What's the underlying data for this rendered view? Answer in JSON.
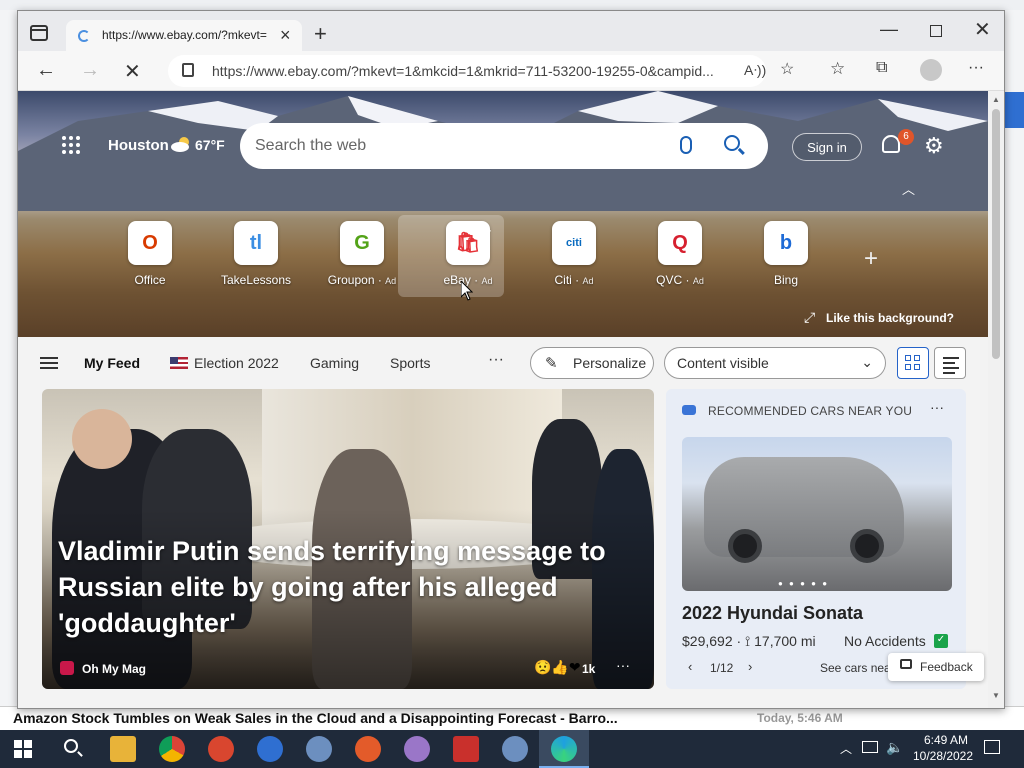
{
  "browser": {
    "tab_title": "https://www.ebay.com/?mkevt=",
    "address": "https://www.ebay.com/?mkevt=1&mkcid=1&mkrid=711-53200-19255-0&campid..."
  },
  "newtab": {
    "weather": {
      "city": "Houston",
      "temp": "67°F"
    },
    "search_placeholder": "Search the web",
    "signin": "Sign in",
    "notifications": "6",
    "quick_links": [
      {
        "label": "Office",
        "ad": "",
        "color": "#d83b01",
        "glyph": "O"
      },
      {
        "label": "TakeLessons",
        "ad": "",
        "color": "#3b8ee3",
        "glyph": "tl"
      },
      {
        "label": "Groupon",
        "ad": "Ad",
        "color": "#53a318",
        "glyph": "G"
      },
      {
        "label": "eBay",
        "ad": "Ad",
        "color": "#e53238",
        "glyph": "🛍"
      },
      {
        "label": "Citi",
        "ad": "Ad",
        "color": "#0a6bbf",
        "glyph": "citi"
      },
      {
        "label": "QVC",
        "ad": "Ad",
        "color": "#d6202f",
        "glyph": "Q"
      },
      {
        "label": "Bing",
        "ad": "",
        "color": "#1e6bd6",
        "glyph": "b"
      }
    ],
    "background_link": "Like this background?"
  },
  "feed_nav": {
    "my_feed": "My Feed",
    "items": [
      "Election 2022",
      "Gaming",
      "Sports"
    ],
    "personalize": "Personalize",
    "content_visible": "Content visible"
  },
  "story": {
    "title": "Vladimir Putin sends terrifying message to Russian elite by going after his alleged 'goddaughter'",
    "source": "Oh My Mag",
    "reactions": "1k"
  },
  "cars": {
    "header": "RECOMMENDED CARS NEAR YOU",
    "title": "2022 Hyundai Sonata",
    "price": "$29,692 · ⟟ 17,700 mi",
    "accidents": "No Accidents",
    "page": "1/12",
    "see_more": "See cars nea"
  },
  "feedback": "Feedback",
  "background_window": {
    "ticker": "Amazon Stock Tumbles on Weak Sales in the Cloud and a Disappointing Forecast - Barro...",
    "ticker_time": "Today, 5:46 AM"
  },
  "taskbar": {
    "time": "6:49 AM",
    "date": "10/28/2022"
  }
}
